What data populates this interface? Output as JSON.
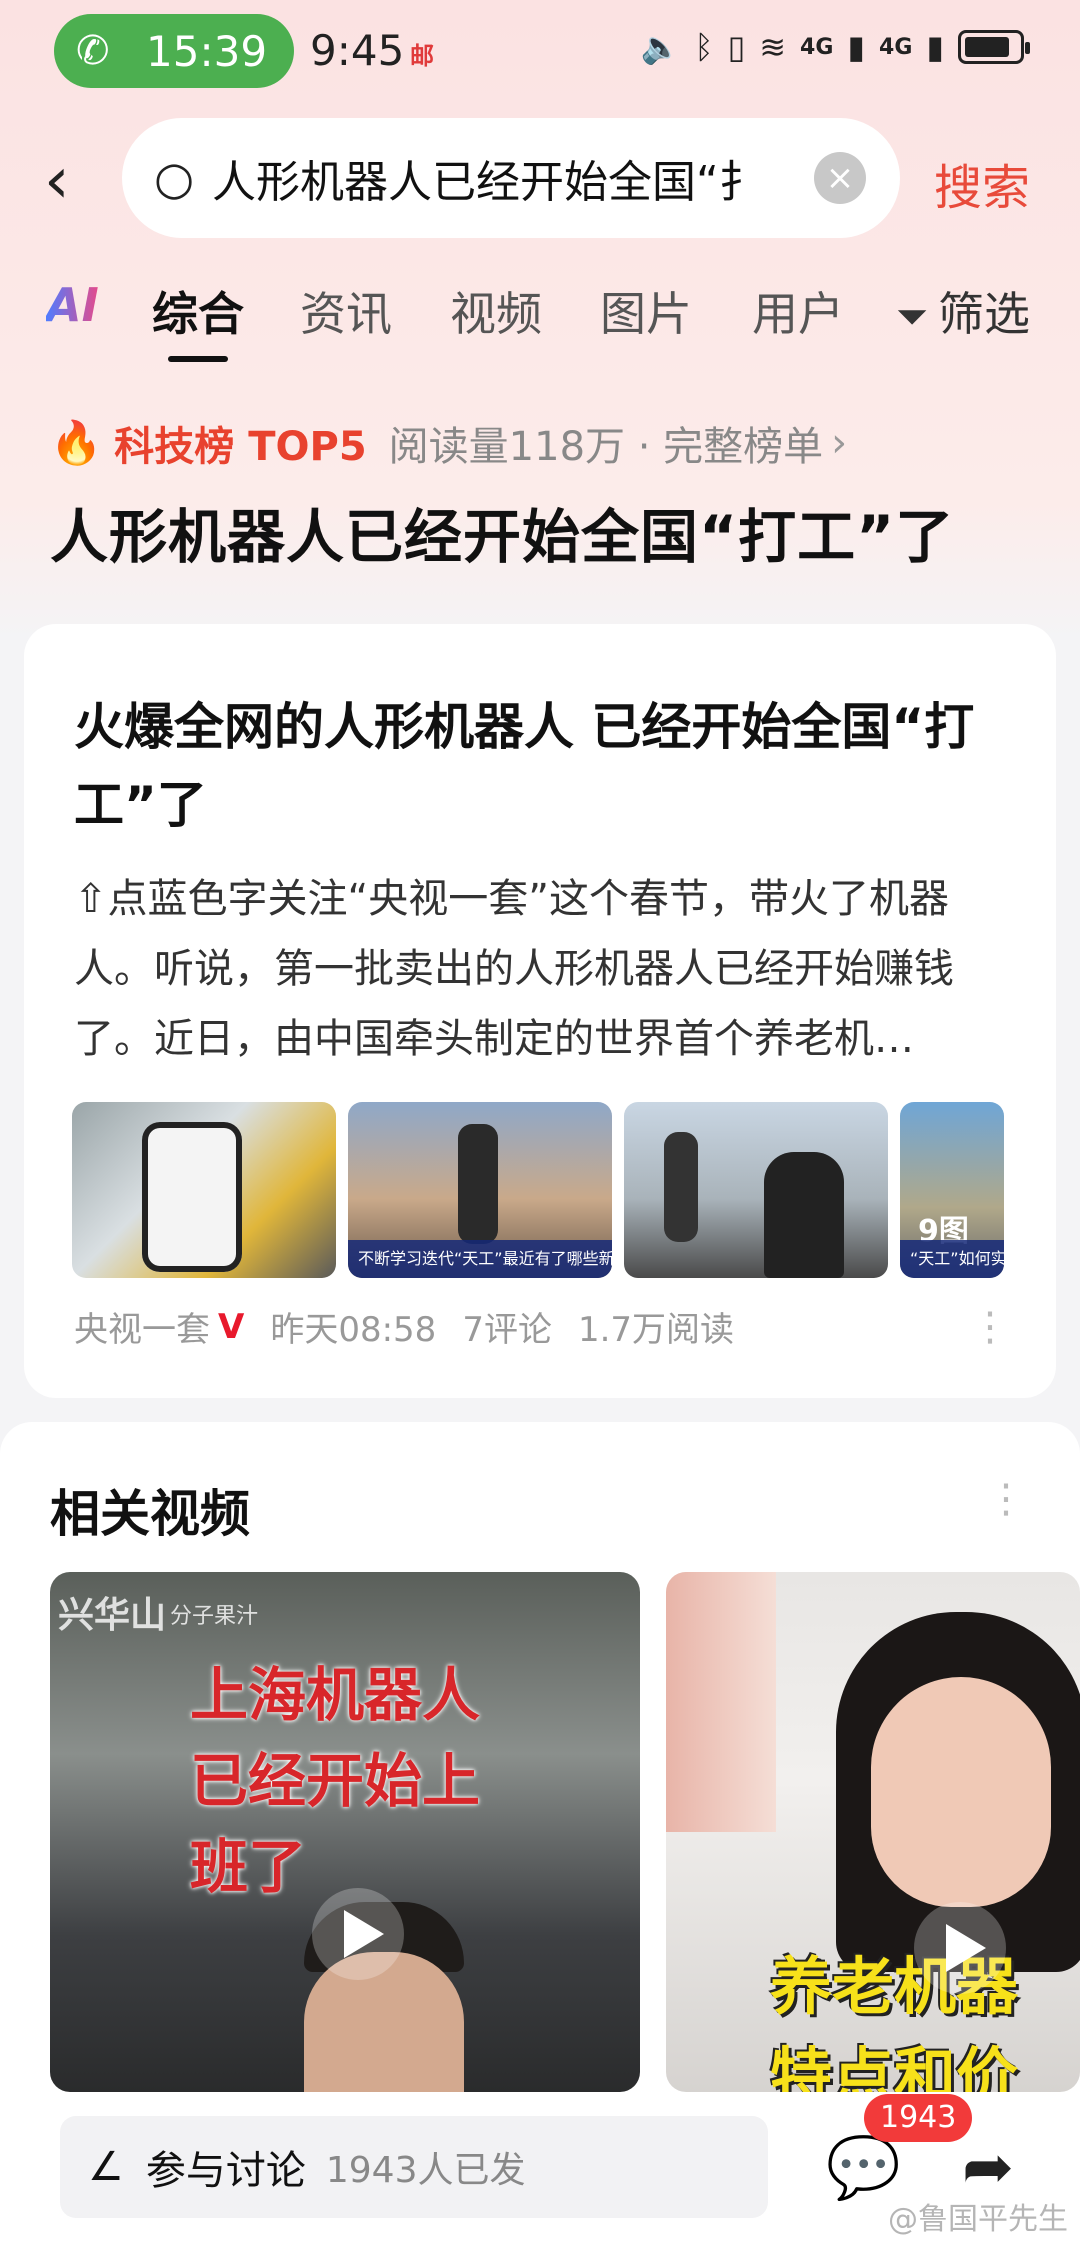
{
  "status_bar": {
    "call_time": "15:39",
    "time": "9:45",
    "badge": "邮",
    "network_1": "4G",
    "network_2": "4G"
  },
  "search": {
    "query": "人形机器人已经开始全国“扌",
    "button_label": "搜索"
  },
  "tabs": {
    "ai": "AI",
    "items": [
      "综合",
      "资讯",
      "视频",
      "图片",
      "用户"
    ],
    "active": "综合",
    "filter_label": "筛选"
  },
  "hot_rank": {
    "rank_label": "科技榜 TOP5",
    "reads": "阅读量118万 · 完整榜单",
    "topic_title": "人形机器人已经开始全国“打工”了"
  },
  "article": {
    "title": "火爆全网的人形机器人 已经开始全国“打工”了",
    "body": "⇧点蓝色字关注“央视一套”这个春节，带火了机器人。听说，第一批卖出的人形机器人已经开始赚钱了。近日，由中国牵头制定的世界首个养老机…",
    "thumb_captions": [
      "",
      "不断学习迭代“天工”最近有了哪些新",
      "",
      "“天工”如何实现雪"
    ],
    "more_images": "9图",
    "source": "央视一套",
    "verified": "V",
    "time": "昨天08:58",
    "comments": "7评论",
    "reads": "1.7万阅读"
  },
  "related_videos": {
    "title": "相关视频",
    "videos": [
      {
        "overlay_text": "上海机器人已经开始上班了",
        "brand": "兴华山",
        "brand_sub": "分子果汁"
      },
      {
        "overlay_text": "养老机器特点和价"
      }
    ]
  },
  "bottom_bar": {
    "discuss_label": "参与讨论",
    "discuss_count": "1943人已发",
    "comment_badge": "1943",
    "watermark": "@鲁国平先生"
  },
  "colors": {
    "accent_red": "#e84a3a",
    "call_green": "#4caf50",
    "badge_red": "#f23a3a"
  },
  "icons": [
    "phone-icon",
    "back-arrow-icon",
    "search-icon",
    "clear-icon",
    "filter-icon",
    "fire-icon",
    "chevron-right-icon",
    "more-vertical-icon",
    "play-icon",
    "pen-icon",
    "comment-icon",
    "share-icon"
  ]
}
